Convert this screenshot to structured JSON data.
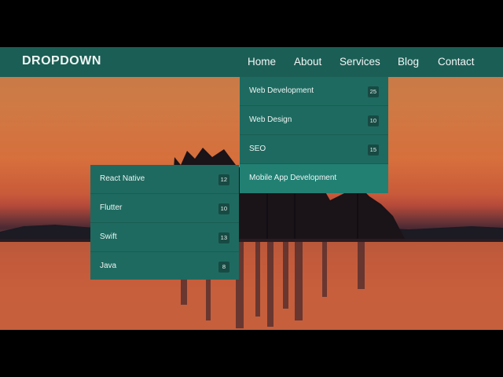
{
  "navbar": {
    "brand": "DROPDOWN",
    "items": [
      "Home",
      "About",
      "Services",
      "Blog",
      "Contact"
    ]
  },
  "services_menu": [
    {
      "label": "Web Development",
      "count": "25"
    },
    {
      "label": "Web Design",
      "count": "10"
    },
    {
      "label": "SEO",
      "count": "15"
    },
    {
      "label": "Mobile App Development",
      "count": ""
    }
  ],
  "mobile_submenu": [
    {
      "label": "React Native",
      "count": "12"
    },
    {
      "label": "Flutter",
      "count": "10"
    },
    {
      "label": "Swift",
      "count": "13"
    },
    {
      "label": "Java",
      "count": "8"
    }
  ],
  "colors": {
    "navbar": "#1b5e55",
    "menu": "#1e6a60",
    "badge": "#174a43",
    "text": "#eef6f4"
  }
}
